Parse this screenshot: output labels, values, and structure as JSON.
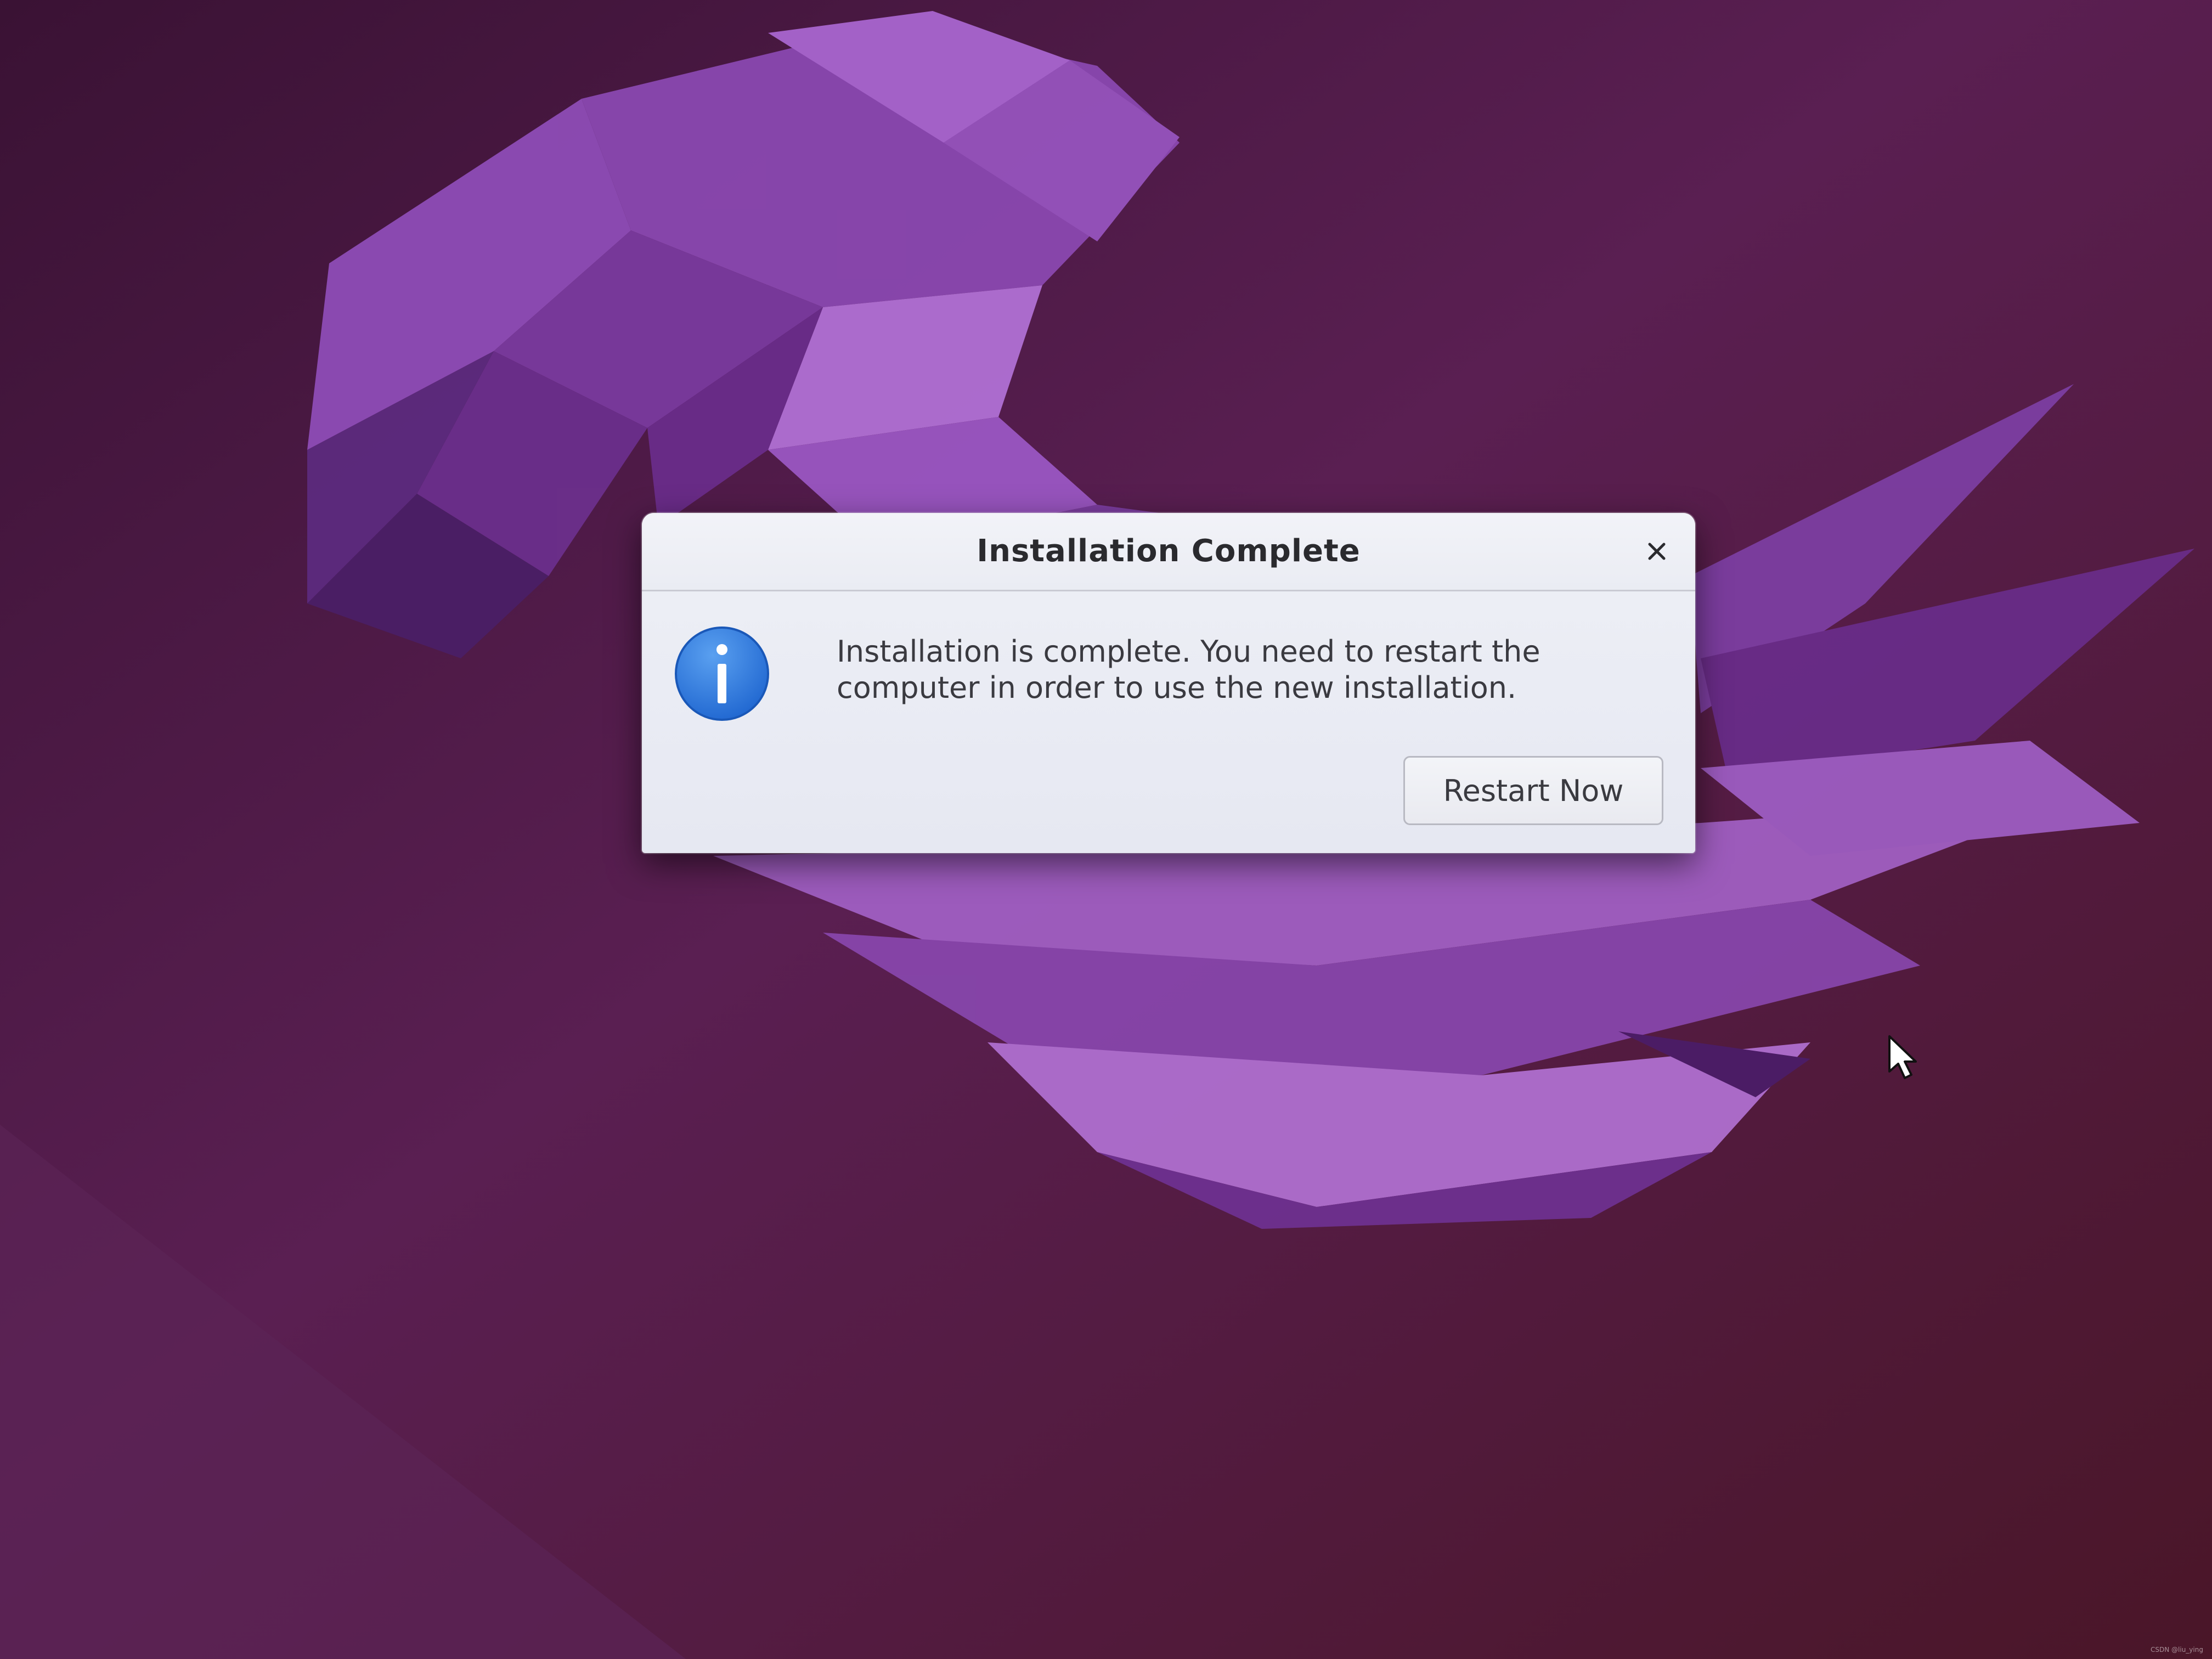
{
  "desktop": {
    "wallpaper": "ubuntu-jammy-jellyfish-wallpaper",
    "cursor": "mouse-pointer-icon"
  },
  "dialog": {
    "title": "Installation Complete",
    "close_icon": "close-icon",
    "info_icon": "info-icon",
    "message": "Installation is complete. You need to restart the computer in order to use the new installation.",
    "restart_label": "Restart Now"
  },
  "watermark": "CSDN @liu_ying",
  "colors": {
    "background": "#4a1a44",
    "jellyfish": "#a45cc4",
    "dialog_bg": "#eceef5",
    "info_blue": "#2f7fe0",
    "text": "#3a3a40"
  }
}
